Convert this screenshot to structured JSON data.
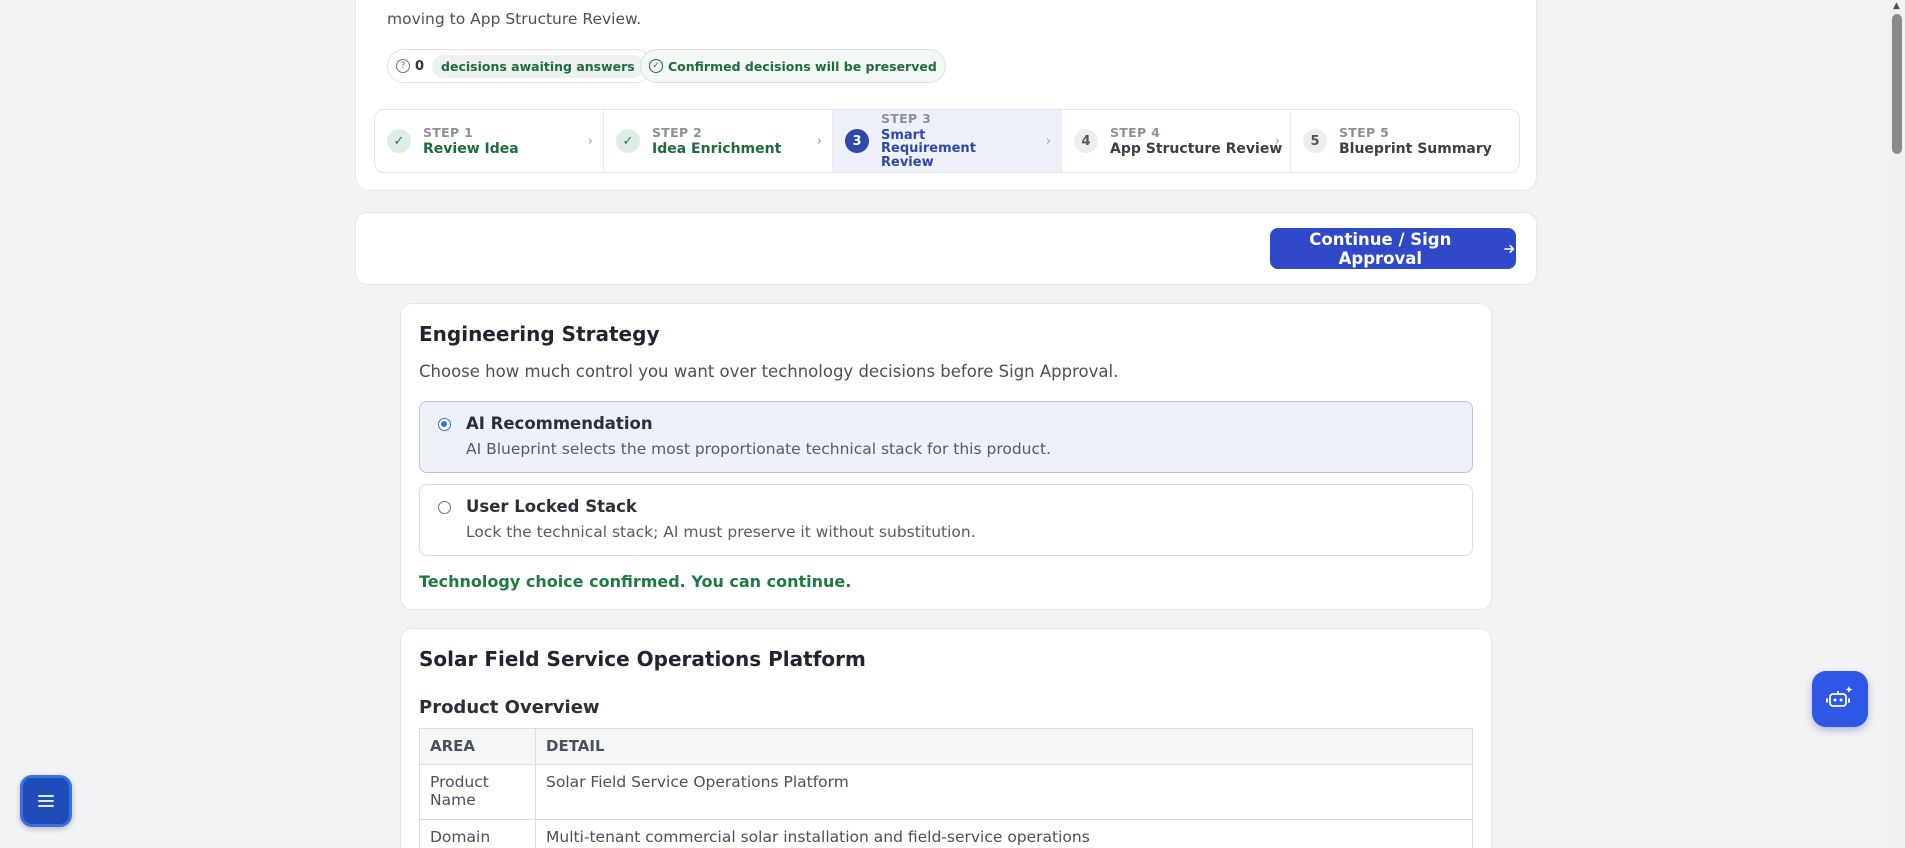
{
  "intro": {
    "text": "moving to App Structure Review."
  },
  "pills": {
    "awaiting_count": "0",
    "awaiting_label": "decisions awaiting answers",
    "preserved_label": "Confirmed decisions will be preserved"
  },
  "steps": [
    {
      "key": "STEP 1",
      "title": "Review Idea",
      "badge": "✓",
      "state": "done"
    },
    {
      "key": "STEP 2",
      "title": "Idea Enrichment",
      "badge": "✓",
      "state": "done"
    },
    {
      "key": "STEP 3",
      "title": "Smart Requirement Review",
      "badge": "3",
      "state": "active"
    },
    {
      "key": "STEP 4",
      "title": "App Structure Review",
      "badge": "4",
      "state": "todo"
    },
    {
      "key": "STEP 5",
      "title": "Blueprint Summary",
      "badge": "5",
      "state": "todo"
    }
  ],
  "action": {
    "continue_label": "Continue / Sign Approval",
    "continue_icon": "arrow-right-icon"
  },
  "strategy": {
    "title": "Engineering Strategy",
    "subtitle": "Choose how much control you want over technology decisions before Sign Approval.",
    "options": [
      {
        "title": "AI Recommendation",
        "desc": "AI Blueprint selects the most proportionate technical stack for this product.",
        "selected": true
      },
      {
        "title": "User Locked Stack",
        "desc": "Lock the technical stack; AI must preserve it without substitution.",
        "selected": false
      }
    ],
    "confirm": "Technology choice confirmed. You can continue."
  },
  "product": {
    "title": "Solar Field Service Operations Platform",
    "section": "Product Overview",
    "headers": [
      "AREA",
      "DETAIL"
    ],
    "rows": [
      {
        "area": "Product Name",
        "detail": "Solar Field Service Operations Platform"
      },
      {
        "area": "Domain",
        "detail": "Multi-tenant commercial solar installation and field-service operations"
      }
    ]
  },
  "colors": {
    "primary": "#2f49c8",
    "success": "#1e7a43",
    "background": "#f2f3f5"
  }
}
